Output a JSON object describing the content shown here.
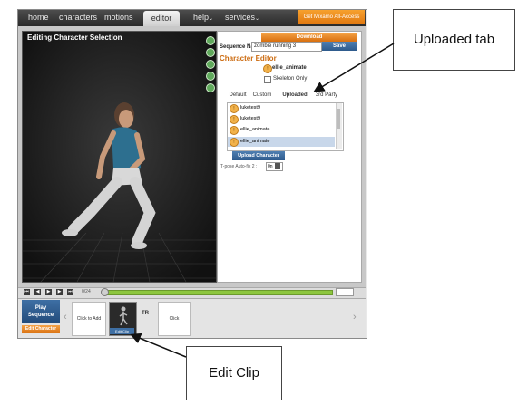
{
  "nav": {
    "items": [
      "home",
      "characters",
      "motions",
      "editor",
      "help",
      "services"
    ],
    "active": "editor",
    "promo_label": "Get Mixamo All-Access"
  },
  "viewport": {
    "title": "Editing Character Selection"
  },
  "panel": {
    "download_label": "Download",
    "sequence_label": "Sequence Name:",
    "sequence_value": "zombie running 3",
    "save_label": "Save",
    "editor_title": "Character Editor",
    "selected_character": "ellie_animate",
    "skeleton_only_label": "Skeleton Only",
    "tabs": [
      "Default",
      "Custom",
      "Uploaded",
      "3rd Party"
    ],
    "active_tab": "Uploaded",
    "characters": [
      "luketest9",
      "luketest9",
      "ellie_animate",
      "ellie_animate"
    ],
    "selected_index": 3,
    "upload_label": "Upload Character",
    "tpose_label": "T-pose Auto-fix 2 :",
    "tpose_value": "0n"
  },
  "transport": {
    "time": "0/24"
  },
  "timeline": {
    "play_label_1": "Play",
    "play_label_2": "Sequence",
    "edit_character_label": "Edit Character",
    "click_to_add": "Click to Add",
    "edit_clip_tag": "Edit Clip",
    "transition": "TR",
    "click": "Click"
  },
  "callouts": {
    "uploaded_tab": "Uploaded tab",
    "edit_clip": "Edit Clip"
  },
  "colors": {
    "accent_orange": "#e07710",
    "accent_blue": "#2d5a8c",
    "progress_green": "#8dc63f"
  }
}
